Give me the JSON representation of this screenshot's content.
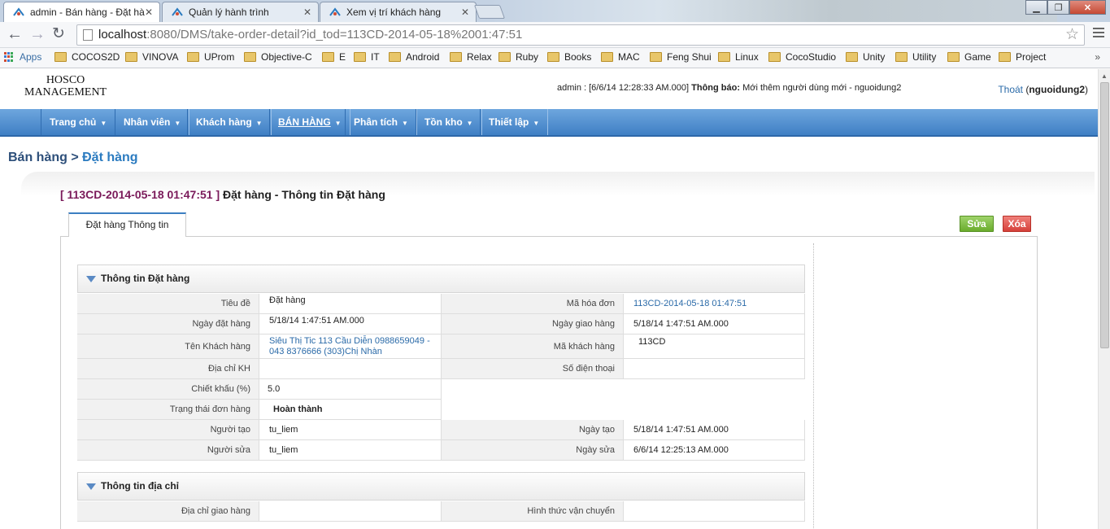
{
  "browser": {
    "tabs": [
      {
        "title": "admin - Bán hàng - Đặt hà"
      },
      {
        "title": "Quản lý hành trình"
      },
      {
        "title": "Xem vị trí khách hàng"
      }
    ],
    "url_host": "localhost",
    "url_rest": ":8080/DMS/take-order-detail?id_tod=113CD-2014-05-18%2001:47:51",
    "bookmarks": [
      "Apps",
      "COCOS2D",
      "VINOVA",
      "UProm",
      "Objective-C",
      "E",
      "IT",
      "Android",
      "Relax",
      "Ruby",
      "Books",
      "MAC",
      "Feng Shui",
      "Linux",
      "CocoStudio",
      "Unity",
      "Utility",
      "Game",
      "Project"
    ]
  },
  "header": {
    "logo_line1": "HOSCO",
    "logo_line2": "MANAGEMENT",
    "user_info": "admin : [6/6/14 12:28:33 AM.000]",
    "notice_label": "Thông báo:",
    "notice_text": "Mới thêm người dùng mới - nguoidung2",
    "logout_label": "Thoát",
    "logout_user": "nguoidung2"
  },
  "nav": [
    "Trang chủ",
    "Nhân viên",
    "Khách hàng",
    "BÁN HÀNG",
    "Phân tích",
    "Tồn kho",
    "Thiết lập"
  ],
  "breadcrumb": {
    "parent": "Bán hàng",
    "separator": " > ",
    "current": "Đặt hàng"
  },
  "order": {
    "code": "[ 113CD-2014-05-18 01:47:51 ]",
    "title": "Đặt hàng - Thông tin Đặt hàng",
    "tab_label": "Đặt hàng Thông tin",
    "edit_label": "Sửa",
    "delete_label": "Xóa"
  },
  "section1": {
    "title": "Thông tin Đặt hàng",
    "rows": [
      {
        "l1": "Tiêu đề",
        "v1": "Đặt hàng",
        "l2": "Mã hóa đơn",
        "v2": "113CD-2014-05-18 01:47:51"
      },
      {
        "l1": "Ngày đặt hàng",
        "v1": "5/18/14 1:47:51 AM.000",
        "l2": "Ngày giao hàng",
        "v2": "5/18/14 1:47:51 AM.000"
      },
      {
        "l1": "Tên Khách hàng",
        "v1": "Siêu Thị Tic 113 Cầu Diễn 0988659049 - 043 8376666 (303)Chị Nhàn",
        "l2": "Mã khách hàng",
        "v2": "113CD"
      },
      {
        "l1": "Địa chỉ KH",
        "v1": "",
        "l2": "Số điện thoại",
        "v2": ""
      },
      {
        "l1": "Chiết khấu (%)",
        "v1": "5.0"
      },
      {
        "l1": "Trạng thái đơn hàng",
        "v1": "Hoàn thành"
      },
      {
        "l1": "Người tạo",
        "v1": "tu_liem",
        "l2": "Ngày tạo",
        "v2": "5/18/14 1:47:51 AM.000"
      },
      {
        "l1": "Người sửa",
        "v1": "tu_liem",
        "l2": "Ngày sửa",
        "v2": "6/6/14 12:25:13 AM.000"
      }
    ]
  },
  "section2": {
    "title": "Thông tin địa chỉ",
    "rows": [
      {
        "l1": "Địa chỉ giao hàng",
        "v1": "",
        "l2": "Hình thức vận chuyển",
        "v2": ""
      }
    ]
  }
}
